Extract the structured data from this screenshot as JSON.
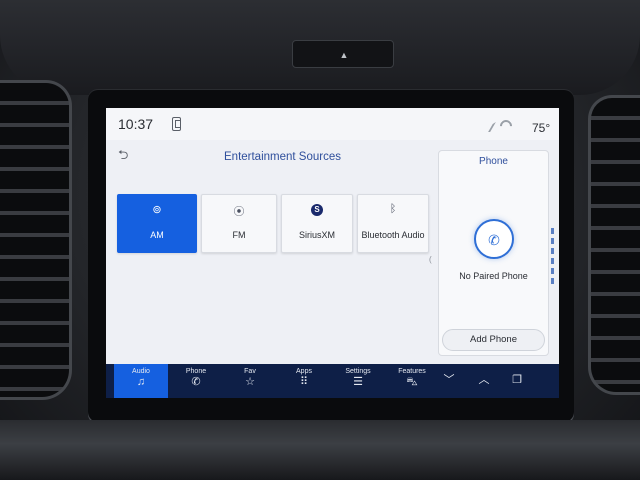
{
  "status_bar": {
    "time": "10:37",
    "temperature": "75°",
    "phone_icon": "phone-icon",
    "signal_icon": "signal-icon",
    "wifi_icon": "wifi-icon"
  },
  "header": {
    "back_icon": "back-arrow-icon",
    "back_glyph": "⮌",
    "title": "Entertainment Sources"
  },
  "sources": [
    {
      "label": "AM",
      "icon": "antenna-icon",
      "glyph": "⊚",
      "active": true
    },
    {
      "label": "FM",
      "icon": "radio-waves-icon",
      "glyph": "⦿",
      "active": false
    },
    {
      "label": "SiriusXM",
      "icon": "siriusxm-logo-icon",
      "glyph": "S",
      "active": false
    },
    {
      "label": "Bluetooth Audio",
      "icon": "bluetooth-icon",
      "glyph": "ᛒ",
      "active": false
    }
  ],
  "phone_panel": {
    "title": "Phone",
    "phone_glyph": "✆",
    "status": "No Paired Phone",
    "add_button": "Add Phone"
  },
  "bottom_nav": {
    "items": [
      {
        "label": "Audio",
        "icon": "music-note-icon",
        "glyph": "♫",
        "active": true
      },
      {
        "label": "Phone",
        "icon": "phone-icon",
        "glyph": "✆",
        "active": false
      },
      {
        "label": "Fav",
        "icon": "star-icon",
        "glyph": "☆",
        "active": false
      },
      {
        "label": "Apps",
        "icon": "apps-grid-icon",
        "glyph": "⠿",
        "active": false
      },
      {
        "label": "Settings",
        "icon": "sliders-icon",
        "glyph": "☰",
        "active": false
      },
      {
        "label": "Features",
        "icon": "car-icon",
        "glyph": "⛍",
        "active": false
      }
    ],
    "down_glyph": "﹀",
    "up_glyph": "︿",
    "split_glyph": "❐"
  },
  "colors": {
    "accent": "#1560e0",
    "nav_background": "#0e1f47",
    "title_text": "#2f4f9c"
  }
}
